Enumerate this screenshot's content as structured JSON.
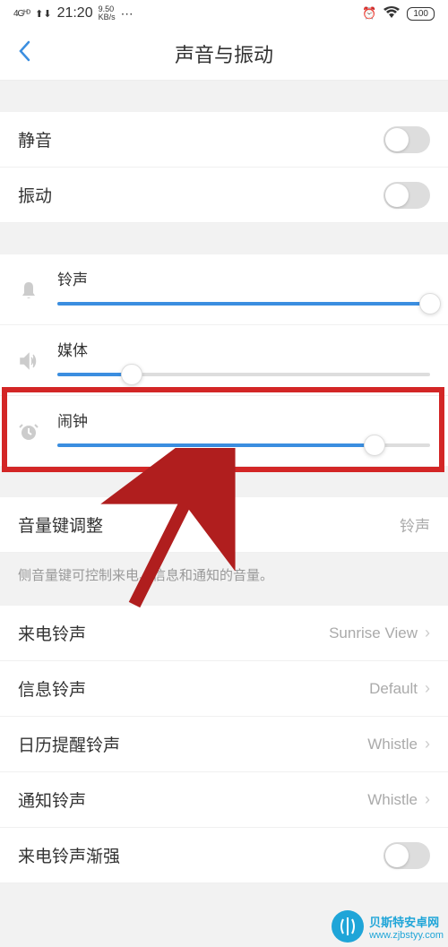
{
  "status": {
    "network": "4Gᴴᴰ",
    "time": "21:20",
    "speed_top": "9.50",
    "speed_bot": "KB/s",
    "battery": "100"
  },
  "header": {
    "title": "声音与振动"
  },
  "toggles": {
    "mute": "静音",
    "vibrate": "振动"
  },
  "sliders": {
    "ringtone": {
      "label": "铃声",
      "value": 100
    },
    "media": {
      "label": "媒体",
      "value": 20
    },
    "alarm": {
      "label": "闹钟",
      "value": 85
    }
  },
  "volume_key": {
    "label": "音量键调整",
    "value": "铃声",
    "helper": "侧音量键可控制来电、信息和通知的音量。"
  },
  "ringtones": {
    "call": {
      "label": "来电铃声",
      "value": "Sunrise View"
    },
    "message": {
      "label": "信息铃声",
      "value": "Default"
    },
    "calendar": {
      "label": "日历提醒铃声",
      "value": "Whistle"
    },
    "notification": {
      "label": "通知铃声",
      "value": "Whistle"
    },
    "gradual": {
      "label": "来电铃声渐强"
    }
  },
  "watermark": {
    "title": "贝斯特安卓网",
    "url": "www.zjbstyy.com"
  }
}
